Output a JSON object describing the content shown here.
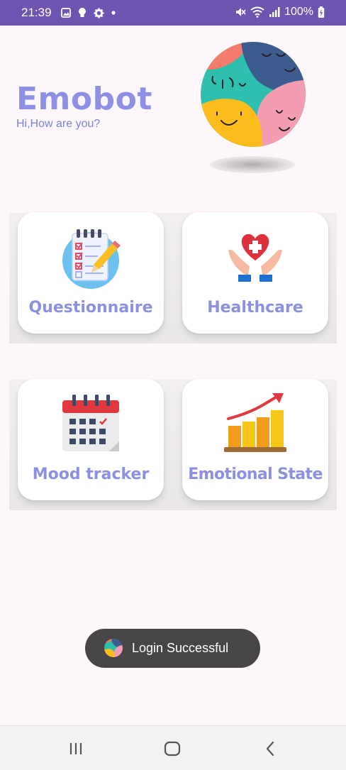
{
  "status_bar": {
    "time": "21:39",
    "battery_text": "100%",
    "left_icons": [
      "image-icon",
      "bulb-icon",
      "gear-icon",
      "dot-icon"
    ],
    "right_icons": [
      "mute-icon",
      "wifi-icon",
      "signal-icon",
      "battery-charging-icon"
    ],
    "background_color": "#6e55b2"
  },
  "header": {
    "title": "Emobot",
    "subtitle": "Hi,How are you?",
    "avatar_icon": "faces-collage-icon",
    "title_color": "#8e91e3"
  },
  "cards": [
    {
      "label": "Questionnaire",
      "icon": "checklist-clipboard-icon"
    },
    {
      "label": "Healthcare",
      "icon": "hands-heart-icon"
    },
    {
      "label": "Mood tracker",
      "icon": "calendar-icon"
    },
    {
      "label": "Emotional State",
      "icon": "growth-bar-chart-icon"
    }
  ],
  "toast": {
    "text": "Login Successful",
    "icon": "app-logo-icon"
  },
  "nav_bar": {
    "buttons": [
      "recent-apps-icon",
      "home-icon",
      "back-icon"
    ]
  },
  "colors": {
    "accent": "#8d90e0",
    "background": "#fdf7fb",
    "toast_bg": "#474547"
  }
}
